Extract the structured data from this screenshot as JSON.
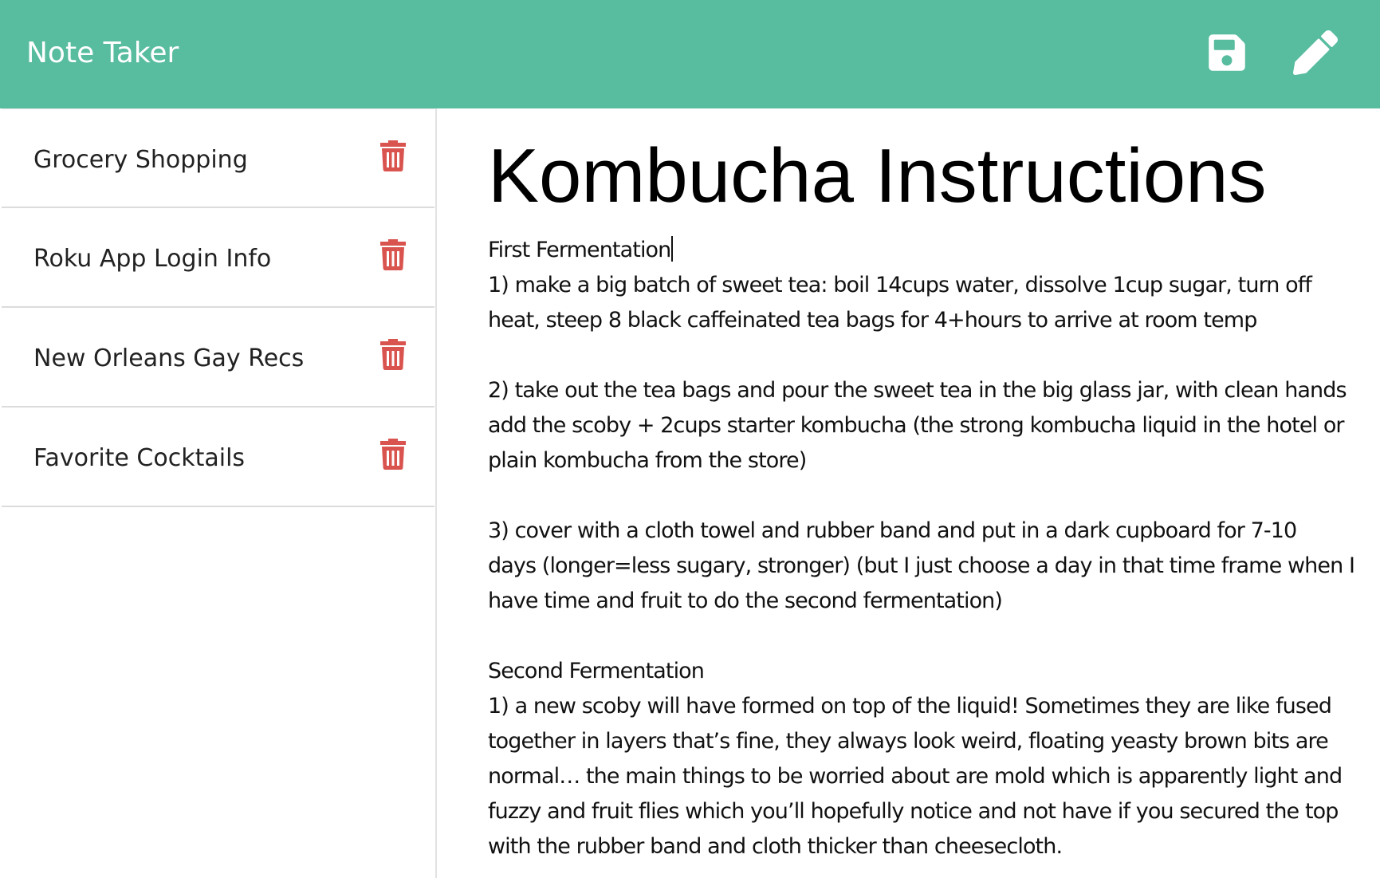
{
  "app": {
    "title": "Note Taker",
    "icons": {
      "save": "save-icon",
      "edit": "pencil-icon"
    },
    "colors": {
      "navbar": "#58bc9f",
      "delete": "#d9534f"
    }
  },
  "sidebar": {
    "notes": [
      {
        "title": "Grocery Shopping",
        "delete_icon": "trash-icon"
      },
      {
        "title": "Roku App Login Info",
        "delete_icon": "trash-icon"
      },
      {
        "title": "New Orleans Gay Recs",
        "delete_icon": "trash-icon"
      },
      {
        "title": "Favorite Cocktails",
        "delete_icon": "trash-icon"
      }
    ]
  },
  "editor": {
    "title": "Kombucha Instructions",
    "body": {
      "l0": "First Fermentation",
      "l1": "1) make a big batch of sweet tea: boil 14cups water, dissolve 1cup sugar, turn off",
      "l2": "heat, steep 8 black caffeinated tea bags for 4+hours to arrive at room temp",
      "l4": "2) take out the tea bags and pour the sweet tea in the big glass jar, with clean hands",
      "l5": "add the scoby + 2cups starter kombucha (the strong kombucha liquid in the hotel or",
      "l6": "plain kombucha from the store)",
      "l8": "3) cover with a cloth towel and rubber band and put in a dark cupboard for 7-10",
      "l9": "days (longer=less sugary, stronger) (but I just choose a day in that time frame when I",
      "l10": "have time and fruit to do the second fermentation)",
      "l12": "Second Fermentation",
      "l13": "1) a new scoby will have formed on top of the liquid! Sometimes they are like fused",
      "l14": "together in layers that’s fine, they always look weird, floating yeasty brown bits are",
      "l15": "normal… the main things to be worried about are mold which is apparently light and",
      "l16": "fuzzy and fruit flies which you’ll hopefully notice and not have if you secured the top",
      "l17": "with the rubber band and cloth thicker than cheesecloth."
    }
  }
}
